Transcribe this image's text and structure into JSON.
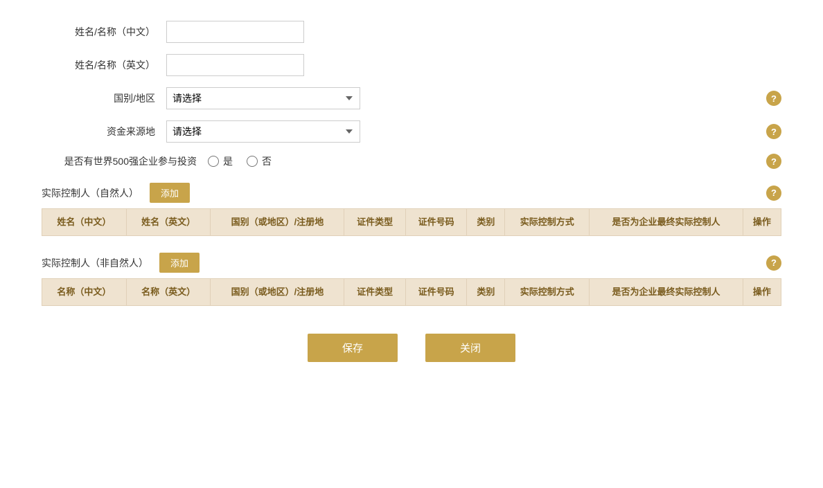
{
  "form": {
    "name_cn_label": "姓名/名称（中文）",
    "name_en_label": "姓名/名称（英文）",
    "country_label": "国别/地区",
    "country_placeholder": "请选择",
    "fund_source_label": "资金来源地",
    "fund_source_placeholder": "请选择",
    "fortune500_label": "是否有世界500强企业参与投资",
    "fortune500_yes": "是",
    "fortune500_no": "否",
    "name_cn_value": "",
    "name_en_value": ""
  },
  "natural_person_section": {
    "title": "实际控制人（自然人）",
    "add_label": "添加",
    "columns": [
      "姓名（中文）",
      "姓名（英文）",
      "国别（或地区）/注册地",
      "证件类型",
      "证件号码",
      "类别",
      "实际控制方式",
      "是否为企业最终实际控制人",
      "操作"
    ]
  },
  "non_natural_person_section": {
    "title": "实际控制人（非自然人）",
    "add_label": "添加",
    "columns": [
      "名称（中文）",
      "名称（英文）",
      "国别（或地区）/注册地",
      "证件类型",
      "证件号码",
      "类别",
      "实际控制方式",
      "是否为企业最终实际控制人",
      "操作"
    ]
  },
  "buttons": {
    "save": "保存",
    "close": "关闭"
  },
  "icons": {
    "help": "?",
    "chevron": "▼"
  },
  "colors": {
    "gold": "#c8a44a",
    "table_header_bg": "#efe3d0",
    "table_bg": "#f5ede0",
    "table_border": "#e0d0b8",
    "header_text": "#7a5c1e"
  }
}
